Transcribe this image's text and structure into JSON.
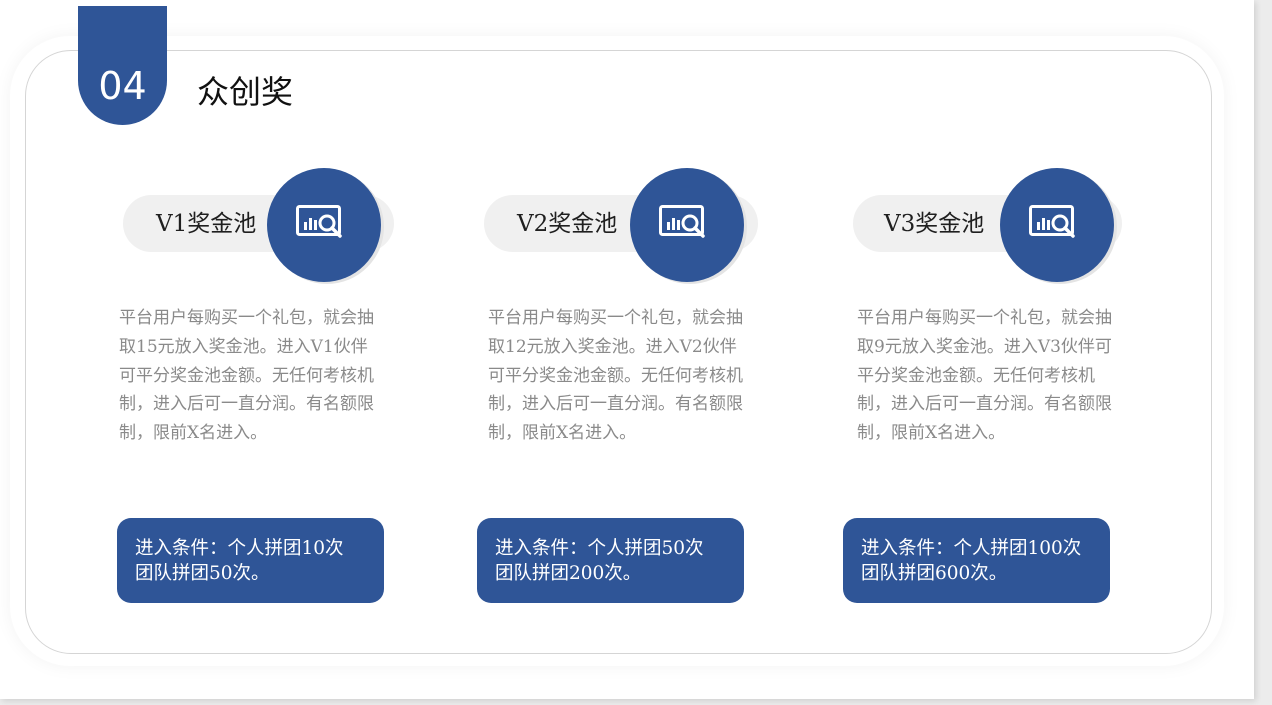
{
  "section": {
    "number": "04",
    "title": "众创奖"
  },
  "theme": {
    "accent": "#2f5597",
    "pill_bg": "#f0f0f0",
    "desc_text": "#8a8a8a"
  },
  "pools": [
    {
      "label": "V1奖金池",
      "icon": "chart-magnifier-icon",
      "description": "平台用户每购买一个礼包，就会抽取15元放入奖金池。进入V1伙伴可平分奖金池金额。无任何考核机制，进入后可一直分润。有名额限制，限前X名进入。",
      "condition_line1": "进入条件：个人拼团10次",
      "condition_line2": "团队拼团50次。"
    },
    {
      "label": "V2奖金池",
      "icon": "chart-magnifier-icon",
      "description": "平台用户每购买一个礼包，就会抽取12元放入奖金池。进入V2伙伴可平分奖金池金额。无任何考核机制，进入后可一直分润。有名额限制，限前X名进入。",
      "condition_line1": "进入条件：个人拼团50次",
      "condition_line2": "团队拼团200次。"
    },
    {
      "label": "V3奖金池",
      "icon": "chart-magnifier-icon",
      "description": "平台用户每购买一个礼包，就会抽取9元放入奖金池。进入V3伙伴可平分奖金池金额。无任何考核机制，进入后可一直分润。有名额限制，限前X名进入。",
      "condition_line1": "进入条件：个人拼团100次",
      "condition_line2": "团队拼团600次。"
    }
  ]
}
